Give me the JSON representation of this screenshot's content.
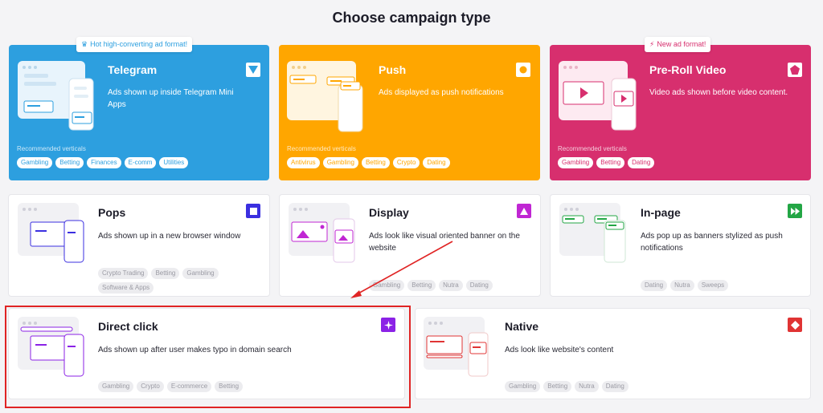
{
  "page": {
    "title": "Choose campaign type"
  },
  "colors": {
    "telegram": "#2d9fdf",
    "push": "#ffa600",
    "preroll": "#d72f6e",
    "pops": "#3b2fe0",
    "display": "#c026d3",
    "inpage": "#23a645",
    "directclick": "#8b22e6",
    "native": "#e03434"
  },
  "cards": {
    "telegram": {
      "title": "Telegram",
      "badge": "Hot high-converting ad format!",
      "badge_icon": "crown-icon",
      "desc": "Ads shown up inside Telegram Mini Apps",
      "rec": "Recommended verticals",
      "tags": [
        "Gambling",
        "Betting",
        "Finances",
        "E-comm",
        "Utilities"
      ],
      "icon": "telegram-triangle-icon"
    },
    "push": {
      "title": "Push",
      "desc": "Ads displayed as push notifications",
      "rec": "Recommended verticals",
      "tags": [
        "Antivirus",
        "Gambling",
        "Betting",
        "Crypto",
        "Dating"
      ],
      "icon": "push-circle-icon"
    },
    "preroll": {
      "title": "Pre-Roll Video",
      "badge": "New ad format!",
      "badge_icon": "lightning-icon",
      "desc": "Video ads shown before video content.",
      "rec": "Recommended verticals",
      "tags": [
        "Gambling",
        "Betting",
        "Dating"
      ],
      "icon": "pentagon-icon"
    },
    "pops": {
      "title": "Pops",
      "desc": "Ads shown up in a new browser window",
      "tags": [
        "Crypto Trading",
        "Betting",
        "Gambling",
        "Software & Apps"
      ],
      "icon": "square-icon"
    },
    "display": {
      "title": "Display",
      "desc": "Ads look like visual oriented banner on the website",
      "tags": [
        "Gambling",
        "Betting",
        "Nutra",
        "Dating"
      ],
      "icon": "triangle-icon"
    },
    "inpage": {
      "title": "In-page",
      "desc": "Ads pop up as banners stylized as push notifications",
      "tags": [
        "Dating",
        "Nutra",
        "Sweeps"
      ],
      "icon": "fast-forward-icon"
    },
    "directclick": {
      "title": "Direct click",
      "desc": "Ads shown up after user makes typo in domain search",
      "tags": [
        "Gambling",
        "Crypto",
        "E-commerce",
        "Betting"
      ],
      "icon": "sparkle-icon"
    },
    "native": {
      "title": "Native",
      "desc": "Ads look like website's content",
      "tags": [
        "Gambling",
        "Betting",
        "Nutra",
        "Dating"
      ],
      "icon": "diamond-icon"
    }
  }
}
